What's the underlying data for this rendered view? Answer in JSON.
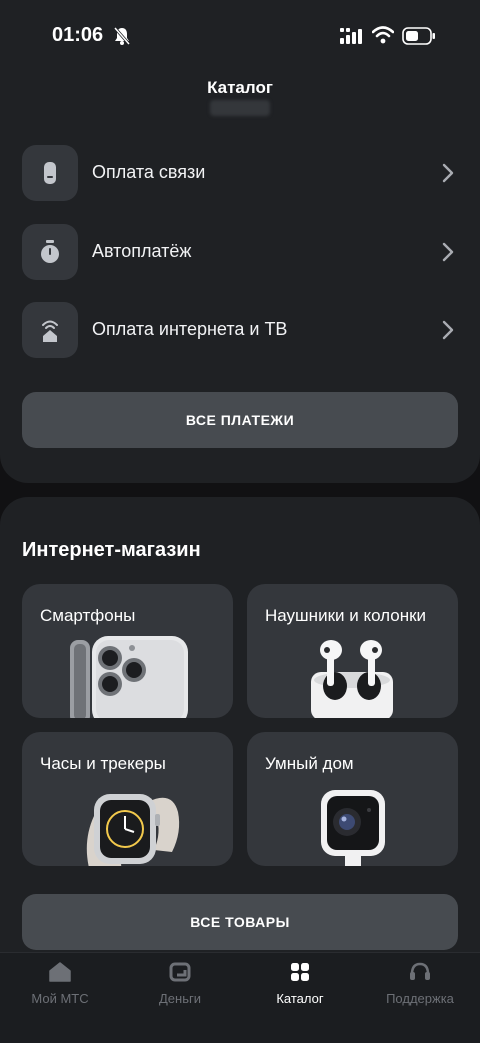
{
  "status_bar": {
    "time": "01:06"
  },
  "header": {
    "title": "Каталог"
  },
  "payments": {
    "items": [
      {
        "label": "Оплата связи",
        "icon": "phone-icon"
      },
      {
        "label": "Автоплатёж",
        "icon": "stopwatch-icon"
      },
      {
        "label": "Оплата интернета и ТВ",
        "icon": "router-icon"
      }
    ],
    "all_button": "ВСЕ ПЛАТЕЖИ"
  },
  "shop": {
    "title": "Интернет-магазин",
    "tiles": [
      {
        "label": "Смартфоны",
        "image": "smartphone-image"
      },
      {
        "label": "Наушники и колонки",
        "image": "earbuds-image"
      },
      {
        "label": "Часы и трекеры",
        "image": "smartwatch-image"
      },
      {
        "label": "Умный дом",
        "image": "camera-image"
      }
    ],
    "all_button": "ВСЕ ТОВАРЫ"
  },
  "tabbar": {
    "tabs": [
      {
        "label": "Мой МТС",
        "icon": "home-icon",
        "active": false
      },
      {
        "label": "Деньги",
        "icon": "wallet-icon",
        "active": false
      },
      {
        "label": "Каталог",
        "icon": "grid-icon",
        "active": true
      },
      {
        "label": "Поддержка",
        "icon": "headset-icon",
        "active": false
      }
    ]
  },
  "colors": {
    "background": "#111113",
    "panel": "#1f2124",
    "tile": "#34373c",
    "button": "#474b50",
    "inactive_tab": "#6d7076"
  }
}
